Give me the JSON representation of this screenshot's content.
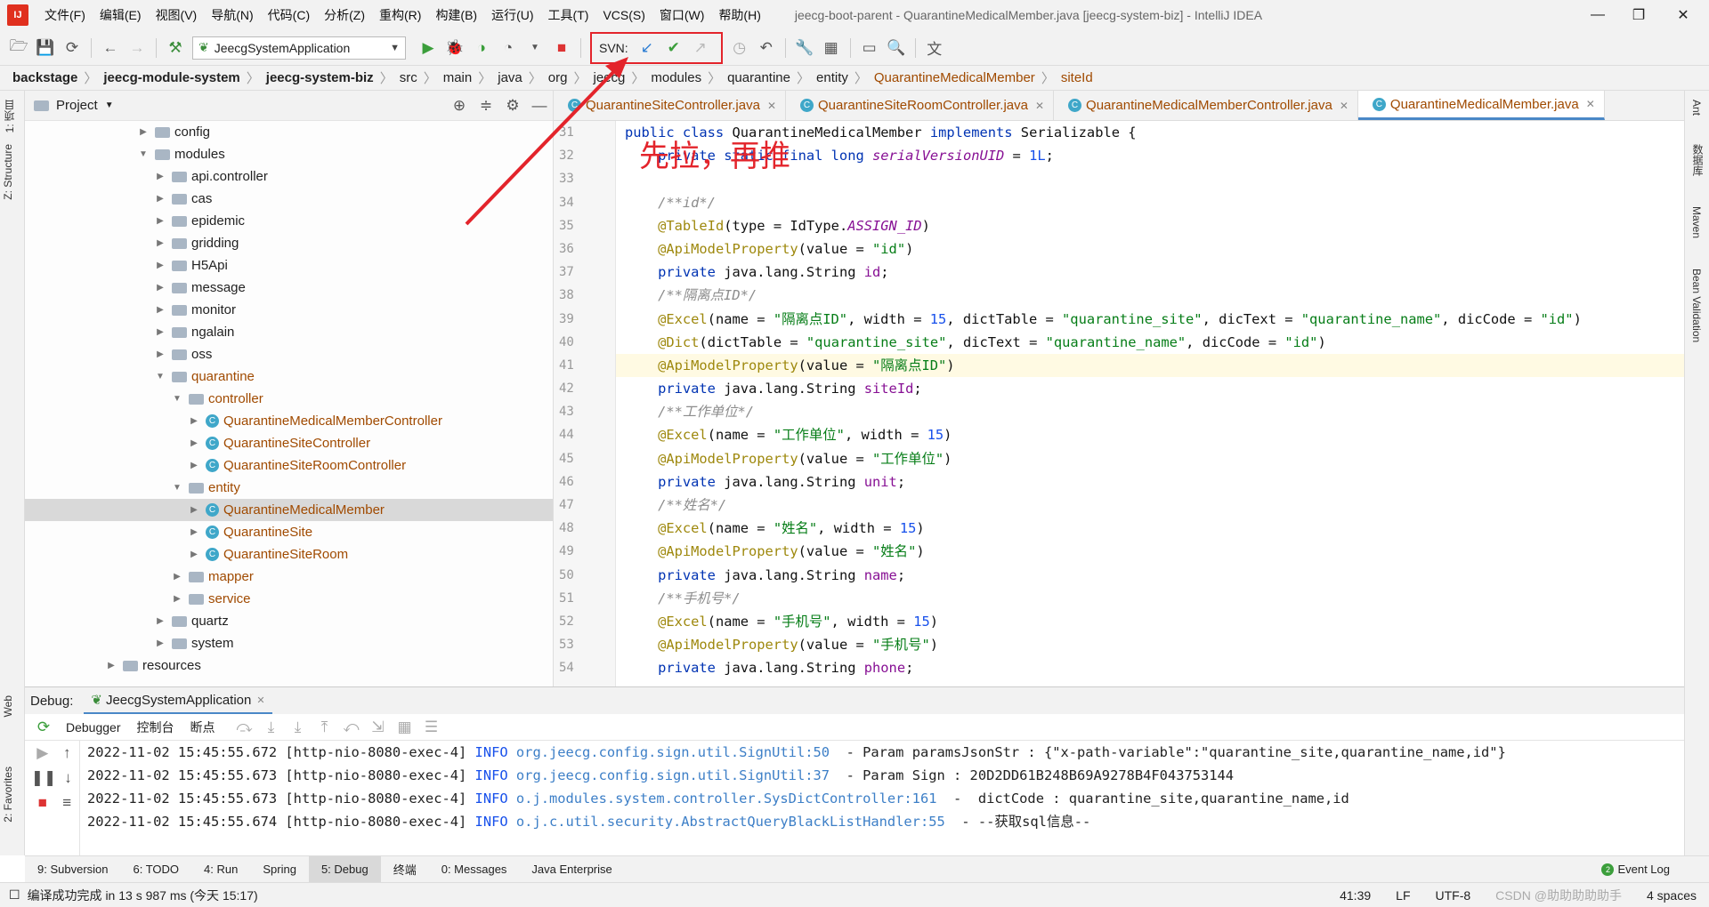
{
  "menubar": {
    "logo": "IJ",
    "items": [
      "文件(F)",
      "编辑(E)",
      "视图(V)",
      "导航(N)",
      "代码(C)",
      "分析(Z)",
      "重构(R)",
      "构建(B)",
      "运行(U)",
      "工具(T)",
      "VCS(S)",
      "窗口(W)",
      "帮助(H)"
    ],
    "title": "jeecg-boot-parent - QuarantineMedicalMember.java [jeecg-system-biz] - IntelliJ IDEA"
  },
  "toolbar": {
    "run_config": "JeecgSystemApplication",
    "svn_label": "SVN:"
  },
  "breadcrumb": [
    "backstage",
    "jeecg-module-system",
    "jeecg-system-biz",
    "src",
    "main",
    "java",
    "org",
    "jeecg",
    "modules",
    "quarantine",
    "entity",
    "QuarantineMedicalMember",
    "siteId"
  ],
  "left_strip": {
    "project": "1: 项目",
    "structure": "Z: Structure",
    "web": "Web",
    "favorites": "2: Favorites"
  },
  "right_strip": {
    "ant": "Ant",
    "database": "数据库",
    "maven": "Maven",
    "bean": "Bean Validation"
  },
  "project": {
    "title": "Project",
    "tree": [
      {
        "label": "config",
        "depth": 0,
        "kind": "folder",
        "open": false
      },
      {
        "label": "modules",
        "depth": 0,
        "kind": "folder",
        "open": true
      },
      {
        "label": "api.controller",
        "depth": 1,
        "kind": "folder",
        "open": false
      },
      {
        "label": "cas",
        "depth": 1,
        "kind": "folder",
        "open": false
      },
      {
        "label": "epidemic",
        "depth": 1,
        "kind": "folder",
        "open": false
      },
      {
        "label": "gridding",
        "depth": 1,
        "kind": "folder",
        "open": false
      },
      {
        "label": "H5Api",
        "depth": 1,
        "kind": "folder",
        "open": false
      },
      {
        "label": "message",
        "depth": 1,
        "kind": "folder",
        "open": false
      },
      {
        "label": "monitor",
        "depth": 1,
        "kind": "folder",
        "open": false
      },
      {
        "label": "ngalain",
        "depth": 1,
        "kind": "folder",
        "open": false
      },
      {
        "label": "oss",
        "depth": 1,
        "kind": "folder",
        "open": false
      },
      {
        "label": "quarantine",
        "depth": 1,
        "kind": "folder",
        "open": true,
        "mod": true
      },
      {
        "label": "controller",
        "depth": 2,
        "kind": "folder",
        "open": true,
        "mod": true
      },
      {
        "label": "QuarantineMedicalMemberController",
        "depth": 3,
        "kind": "class"
      },
      {
        "label": "QuarantineSiteController",
        "depth": 3,
        "kind": "class"
      },
      {
        "label": "QuarantineSiteRoomController",
        "depth": 3,
        "kind": "class"
      },
      {
        "label": "entity",
        "depth": 2,
        "kind": "folder",
        "open": true,
        "mod": true
      },
      {
        "label": "QuarantineMedicalMember",
        "depth": 3,
        "kind": "class",
        "selected": true
      },
      {
        "label": "QuarantineSite",
        "depth": 3,
        "kind": "class"
      },
      {
        "label": "QuarantineSiteRoom",
        "depth": 3,
        "kind": "class"
      },
      {
        "label": "mapper",
        "depth": 2,
        "kind": "folder",
        "open": false,
        "mod": true
      },
      {
        "label": "service",
        "depth": 2,
        "kind": "folder",
        "open": false,
        "mod": true
      },
      {
        "label": "quartz",
        "depth": 1,
        "kind": "folder",
        "open": false
      },
      {
        "label": "system",
        "depth": 1,
        "kind": "folder",
        "open": false
      },
      {
        "label": "resources",
        "depth": -1,
        "kind": "folder",
        "open": false
      }
    ]
  },
  "tabs": [
    {
      "label": "QuarantineSiteController.java",
      "active": false
    },
    {
      "label": "QuarantineSiteRoomController.java",
      "active": false
    },
    {
      "label": "QuarantineMedicalMemberController.java",
      "active": false
    },
    {
      "label": "QuarantineMedicalMember.java",
      "active": true
    }
  ],
  "code": [
    {
      "n": "31",
      "html": "<span class='kw'>public class</span> QuarantineMedicalMember <span class='kw'>implements</span> Serializable {"
    },
    {
      "n": "32",
      "html": "    <span class='kw'>private static final long</span> <span class='fi'>serialVersionUID</span> = <span class='nu'>1L</span>;"
    },
    {
      "n": "33",
      "html": ""
    },
    {
      "n": "34",
      "html": "    <span class='cm'>/**id*/</span>"
    },
    {
      "n": "35",
      "html": "    <span class='an'>@TableId</span>(type = IdType.<span class='fi'>ASSIGN_ID</span>)"
    },
    {
      "n": "36",
      "html": "    <span class='an'>@ApiModelProperty</span>(value = <span class='st'>\"id\"</span>)"
    },
    {
      "n": "37",
      "html": "    <span class='kw'>private</span> java.lang.String <span class='fi' style='font-style:normal'>id</span>;"
    },
    {
      "n": "38",
      "html": "    <span class='cm'>/**隔离点ID*/</span>"
    },
    {
      "n": "39",
      "html": "    <span class='an'>@Excel</span>(name = <span class='st'>\"隔离点ID\"</span>, width = <span class='nu'>15</span>, dictTable = <span class='st'>\"quarantine_site\"</span>, dicText = <span class='st'>\"quarantine_name\"</span>, dicCode = <span class='st'>\"id\"</span>)"
    },
    {
      "n": "40",
      "html": "    <span class='an'>@Dict</span>(dictTable = <span class='st'>\"quarantine_site\"</span>, dicText = <span class='st'>\"quarantine_name\"</span>, dicCode = <span class='st'>\"id\"</span>)"
    },
    {
      "n": "41",
      "html": "    <span class='an'>@ApiModelProperty</span>(value = <span class='st'>\"隔离点ID\"</span>)",
      "cur": true
    },
    {
      "n": "42",
      "html": "    <span class='kw'>private</span> java.lang.String <span class='fi' style='font-style:normal'>siteId</span>;"
    },
    {
      "n": "43",
      "html": "    <span class='cm'>/**工作单位*/</span>"
    },
    {
      "n": "44",
      "html": "    <span class='an'>@Excel</span>(name = <span class='st'>\"工作单位\"</span>, width = <span class='nu'>15</span>)"
    },
    {
      "n": "45",
      "html": "    <span class='an'>@ApiModelProperty</span>(value = <span class='st'>\"工作单位\"</span>)"
    },
    {
      "n": "46",
      "html": "    <span class='kw'>private</span> java.lang.String <span class='fi' style='font-style:normal'>unit</span>;"
    },
    {
      "n": "47",
      "html": "    <span class='cm'>/**姓名*/</span>"
    },
    {
      "n": "48",
      "html": "    <span class='an'>@Excel</span>(name = <span class='st'>\"姓名\"</span>, width = <span class='nu'>15</span>)"
    },
    {
      "n": "49",
      "html": "    <span class='an'>@ApiModelProperty</span>(value = <span class='st'>\"姓名\"</span>)"
    },
    {
      "n": "50",
      "html": "    <span class='kw'>private</span> java.lang.String <span class='fi' style='font-style:normal'>name</span>;"
    },
    {
      "n": "51",
      "html": "    <span class='cm'>/**手机号*/</span>"
    },
    {
      "n": "52",
      "html": "    <span class='an'>@Excel</span>(name = <span class='st'>\"手机号\"</span>, width = <span class='nu'>15</span>)"
    },
    {
      "n": "53",
      "html": "    <span class='an'>@ApiModelProperty</span>(value = <span class='st'>\"手机号\"</span>)"
    },
    {
      "n": "54",
      "html": "    <span class='kw'>private</span> java.lang.String <span class='fi' style='font-style:normal'>phone</span>;"
    }
  ],
  "annotation": "先拉，再推",
  "debug": {
    "label": "Debug:",
    "session": "JeecgSystemApplication",
    "tools": [
      "Debugger",
      "控制台",
      "断点"
    ],
    "log": [
      {
        "ts": "2022-11-02 15:45:55.672",
        "th": "[http-nio-8080-exec-4]",
        "lvl": "INFO",
        "src": "org.jeecg.config.sign.util.SignUtil:50",
        "msg": " - Param paramsJsonStr : {\"x-path-variable\":\"quarantine_site,quarantine_name,id\"}"
      },
      {
        "ts": "2022-11-02 15:45:55.673",
        "th": "[http-nio-8080-exec-4]",
        "lvl": "INFO",
        "src": "org.jeecg.config.sign.util.SignUtil:37",
        "msg": " - Param Sign : 20D2DD61B248B69A9278B4F043753144"
      },
      {
        "ts": "2022-11-02 15:45:55.673",
        "th": "[http-nio-8080-exec-4]",
        "lvl": "INFO",
        "src": "o.j.modules.system.controller.SysDictController:161",
        "msg": " -  dictCode : quarantine_site,quarantine_name,id"
      },
      {
        "ts": "2022-11-02 15:45:55.674",
        "th": "[http-nio-8080-exec-4]",
        "lvl": "INFO",
        "src": "o.j.c.util.security.AbstractQueryBlackListHandler:55",
        "msg": " - --获取sql信息--"
      }
    ]
  },
  "bottom_tabs": [
    "9: Subversion",
    "6: TODO",
    "4: Run",
    "Spring",
    "5: Debug",
    "终端",
    "0: Messages",
    "Java Enterprise"
  ],
  "event_log": "Event Log",
  "status": {
    "message": "编译成功完成 in 13 s 987 ms (今天 15:17)",
    "position": "41:39",
    "line_sep": "LF",
    "encoding": "UTF-8",
    "watermark": "CSDN @助助助助助手",
    "indent": "4 spaces"
  }
}
